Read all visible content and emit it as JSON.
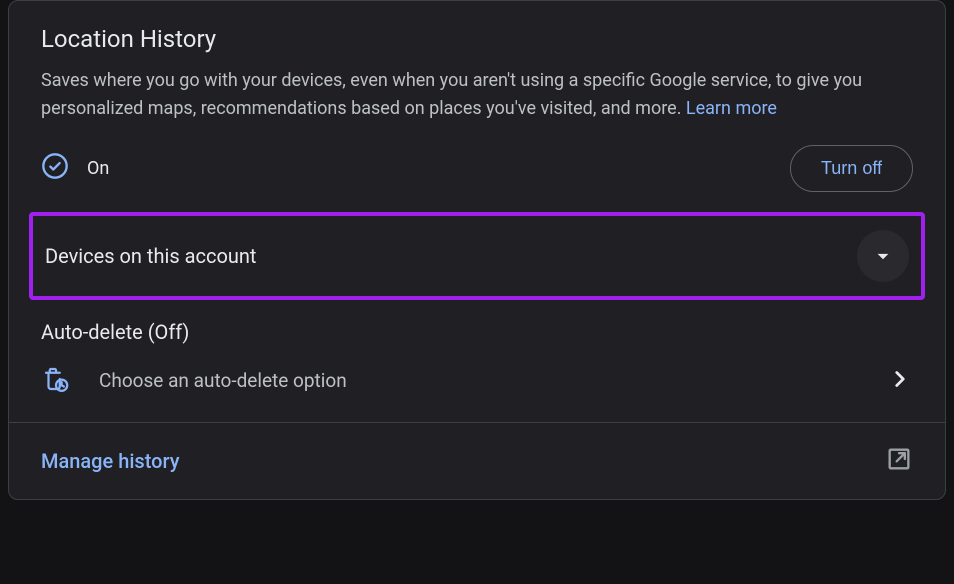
{
  "header": {
    "title": "Location History",
    "description": "Saves where you go with your devices, even when you aren't using a specific Google service, to give you personalized maps, recommendations based on places you've visited, and more. ",
    "learnMore": "Learn more"
  },
  "status": {
    "label": "On",
    "turnOffLabel": "Turn off"
  },
  "devices": {
    "label": "Devices on this account"
  },
  "autoDelete": {
    "title": "Auto-delete (Off)",
    "optionLabel": "Choose an auto-delete option"
  },
  "footer": {
    "manageLabel": "Manage history"
  }
}
